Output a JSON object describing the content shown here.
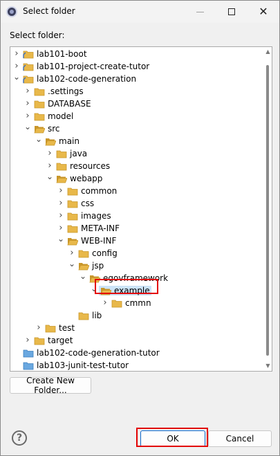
{
  "window": {
    "title": "Select folder",
    "controls": {
      "minimize": "minimize-icon",
      "maximize": "maximize-icon",
      "close": "close-icon"
    }
  },
  "prompt_label": "Select folder:",
  "tree": {
    "items": [
      {
        "label": "lab101-boot",
        "depth": 0,
        "toggle": "collapsed",
        "icon": "project-folder-icon"
      },
      {
        "label": "lab101-project-create-tutor",
        "depth": 0,
        "toggle": "collapsed",
        "icon": "project-folder-icon"
      },
      {
        "label": "lab102-code-generation",
        "depth": 0,
        "toggle": "expanded",
        "icon": "project-folder-icon"
      },
      {
        "label": ".settings",
        "depth": 1,
        "toggle": "collapsed",
        "icon": "folder-icon"
      },
      {
        "label": "DATABASE",
        "depth": 1,
        "toggle": "collapsed",
        "icon": "folder-icon"
      },
      {
        "label": "model",
        "depth": 1,
        "toggle": "collapsed",
        "icon": "folder-icon"
      },
      {
        "label": "src",
        "depth": 1,
        "toggle": "expanded",
        "icon": "open-folder-icon"
      },
      {
        "label": "main",
        "depth": 2,
        "toggle": "expanded",
        "icon": "open-folder-icon"
      },
      {
        "label": "java",
        "depth": 3,
        "toggle": "collapsed",
        "icon": "folder-icon"
      },
      {
        "label": "resources",
        "depth": 3,
        "toggle": "collapsed",
        "icon": "folder-icon"
      },
      {
        "label": "webapp",
        "depth": 3,
        "toggle": "expanded",
        "icon": "open-folder-icon"
      },
      {
        "label": "common",
        "depth": 4,
        "toggle": "collapsed",
        "icon": "folder-icon"
      },
      {
        "label": "css",
        "depth": 4,
        "toggle": "collapsed",
        "icon": "folder-icon"
      },
      {
        "label": "images",
        "depth": 4,
        "toggle": "collapsed",
        "icon": "folder-icon"
      },
      {
        "label": "META-INF",
        "depth": 4,
        "toggle": "collapsed",
        "icon": "folder-icon"
      },
      {
        "label": "WEB-INF",
        "depth": 4,
        "toggle": "expanded",
        "icon": "open-folder-icon"
      },
      {
        "label": "config",
        "depth": 5,
        "toggle": "collapsed",
        "icon": "folder-icon"
      },
      {
        "label": "jsp",
        "depth": 5,
        "toggle": "expanded",
        "icon": "open-folder-icon"
      },
      {
        "label": "egovframework",
        "depth": 6,
        "toggle": "expanded",
        "icon": "open-folder-icon"
      },
      {
        "label": "example",
        "depth": 7,
        "toggle": "expanded",
        "icon": "open-folder-icon",
        "selected": true
      },
      {
        "label": "cmmn",
        "depth": 8,
        "toggle": "collapsed",
        "icon": "folder-icon"
      },
      {
        "label": "lib",
        "depth": 5,
        "toggle": "none",
        "icon": "folder-icon"
      },
      {
        "label": "test",
        "depth": 2,
        "toggle": "collapsed",
        "icon": "folder-icon"
      },
      {
        "label": "target",
        "depth": 1,
        "toggle": "collapsed",
        "icon": "folder-icon"
      },
      {
        "label": "lab102-code-generation-tutor",
        "depth": 0,
        "toggle": "none",
        "icon": "closed-project-icon"
      },
      {
        "label": "lab103-junit-test-tutor",
        "depth": 0,
        "toggle": "none",
        "icon": "closed-project-icon"
      }
    ]
  },
  "buttons": {
    "create_new_folder": "Create New Folder...",
    "ok": "OK",
    "cancel": "Cancel",
    "help": "?"
  },
  "colors": {
    "folder": "#e8b84a",
    "folder_dark": "#c8962a",
    "selection": "#cce4f7",
    "highlight_box": "#e30000",
    "closed_project": "#6aa8e0"
  }
}
